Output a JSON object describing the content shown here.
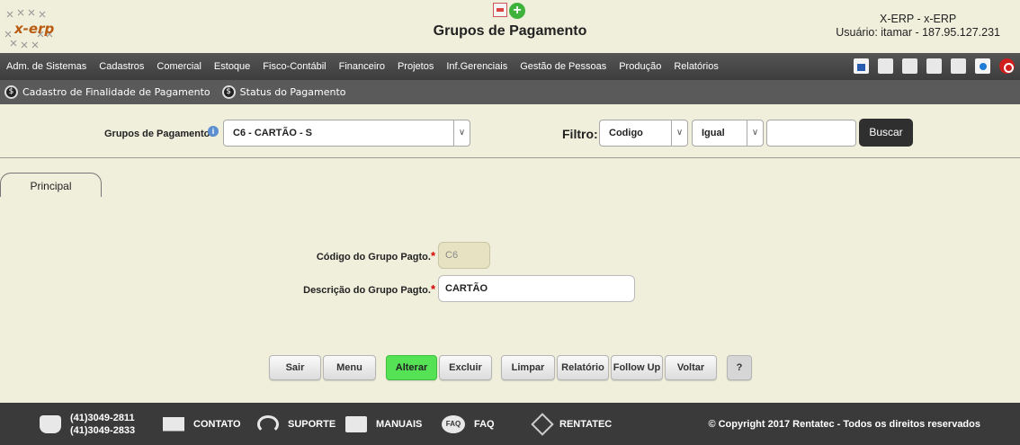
{
  "header": {
    "logo_text": "x-erp",
    "page_title": "Grupos de Pagamento",
    "system": "X-ERP - x-ERP",
    "user": "Usuário: itamar - 187.95.127.231"
  },
  "menu": {
    "items": [
      "Adm. de Sistemas",
      "Cadastros",
      "Comercial",
      "Estoque",
      "Fisco-Contábil",
      "Financeiro",
      "Projetos",
      "Inf.Gerenciais",
      "Gestão de Pessoas",
      "Produção",
      "Relatórios"
    ]
  },
  "submenu": {
    "items": [
      "Cadastro de Finalidade de Pagamento",
      "Status do Pagamento"
    ]
  },
  "filter": {
    "group_label": "Grupos de Pagamentos",
    "group_value": "C6 - CARTÃO - S",
    "filtro_label": "Filtro:",
    "field_value": "Codigo",
    "operator_value": "Igual",
    "search_value": "",
    "search_button": "Buscar"
  },
  "tabs": [
    "Principal"
  ],
  "form": {
    "code_label": "Código do Grupo Pagto.",
    "code_value": "C6",
    "desc_label": "Descrição do Grupo Pagto.",
    "desc_value": "CARTÃO",
    "required_mark": "*"
  },
  "buttons": {
    "sair": "Sair",
    "menu": "Menu",
    "alterar": "Alterar",
    "excluir": "Excluir",
    "limpar": "Limpar",
    "relatorio": "Relatório",
    "followup": "Follow Up",
    "voltar": "Voltar",
    "help": "?"
  },
  "footer": {
    "phone1": "(41)3049-2811",
    "phone2": "(41)3049-2833",
    "contato": "CONTATO",
    "suporte": "SUPORTE",
    "manuais": "MANUAIS",
    "faq": "FAQ",
    "faq_icon_text": "FAQ",
    "rentatec": "RENTATEC",
    "copyright": "© Copyright 2017 Rentatec - Todos os direitos reservados"
  },
  "colors": {
    "background": "#f0efdc",
    "menubar": "#3d3d3d",
    "accent_green": "#55e255",
    "footer": "#3a3a3a"
  }
}
